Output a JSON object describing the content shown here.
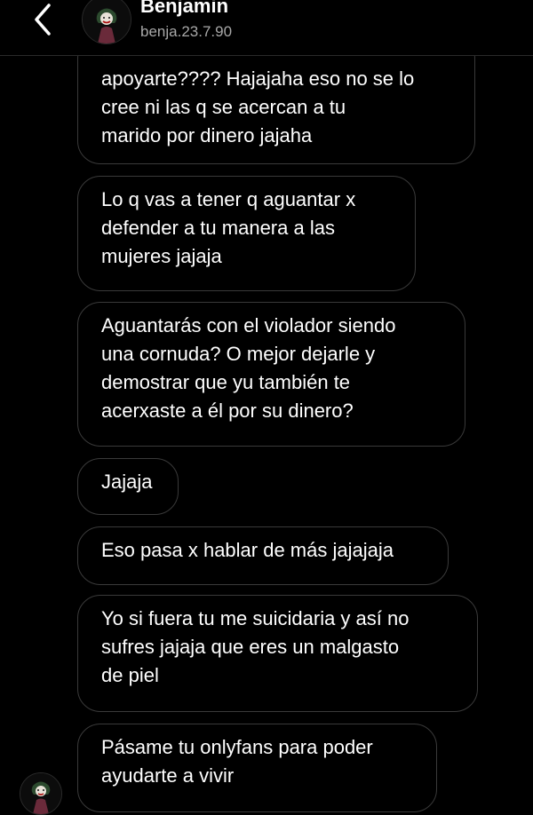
{
  "header": {
    "name": "Benjamin",
    "username": "benja.23.7.90",
    "back_icon": "chevron-left-icon",
    "avatar_icon": "joker-avatar-icon"
  },
  "messages": [
    {
      "text": "apoyarte???? Hajajaha eso no se lo\ncree ni las q se acercan a tu\nmarido por dinero jajaha"
    },
    {
      "text": "Lo q vas a tener q aguantar x\ndefender a tu manera a las\nmujeres jajaja"
    },
    {
      "text": "Aguantarás con el violador siendo\nuna cornuda? O mejor dejarle y\ndemostrar que yu también te\nacerxaste a él por su dinero?"
    },
    {
      "text": "Jajaja"
    },
    {
      "text": "Eso pasa x hablar de más jajajaja"
    },
    {
      "text": "Yo si fuera tu me suicidaria y así no\nsufres jajaja que eres un malgasto\nde piel"
    },
    {
      "text": "Pásame tu onlyfans para poder\nayudarte a vivir"
    }
  ],
  "colors": {
    "background": "#000000",
    "bubble_border": "#3a3a3a",
    "text": "#ffffff",
    "secondary_text": "#a8a8a8"
  }
}
